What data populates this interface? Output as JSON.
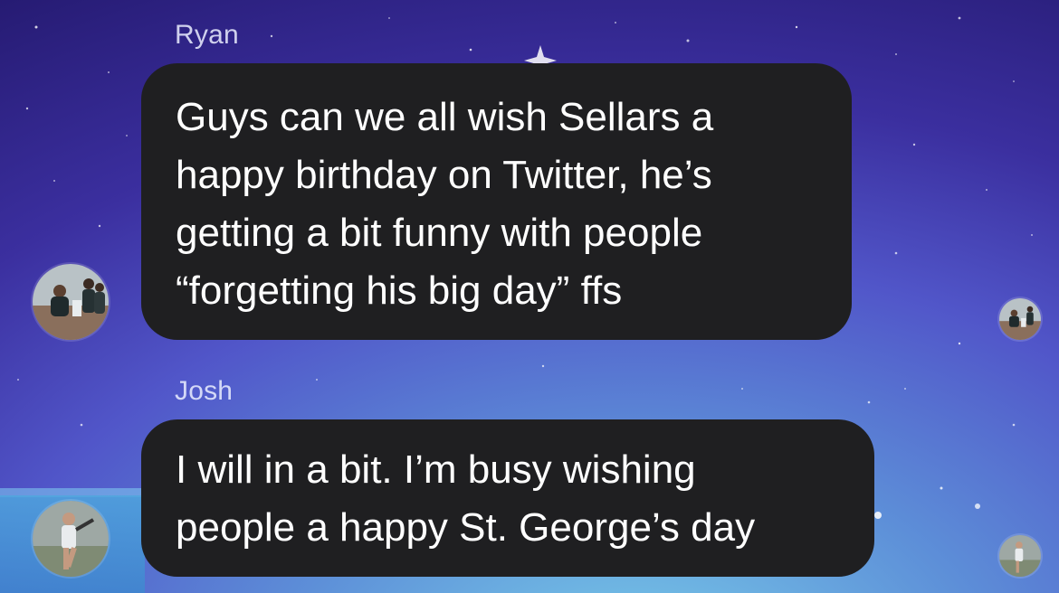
{
  "conversation": {
    "messages": [
      {
        "sender": "Ryan",
        "avatar_icon": "group-photo-avatar",
        "lines": [
          "Guys can we all wish Sellars a",
          "happy birthday on Twitter, he’s",
          "getting a bit funny with people",
          "“forgetting his big day” ffs"
        ]
      },
      {
        "sender": "Josh",
        "avatar_icon": "tennis-player-avatar",
        "lines": [
          "I will in a bit. I’m busy wishing",
          "people a happy St. George’s day"
        ]
      }
    ],
    "read_receipts": [
      {
        "icon": "group-photo-read-receipt"
      },
      {
        "icon": "tennis-player-read-receipt"
      }
    ]
  },
  "colors": {
    "bubble": "#1f1f21",
    "text": "#ffffff",
    "sender_label": "#ebeeff"
  }
}
